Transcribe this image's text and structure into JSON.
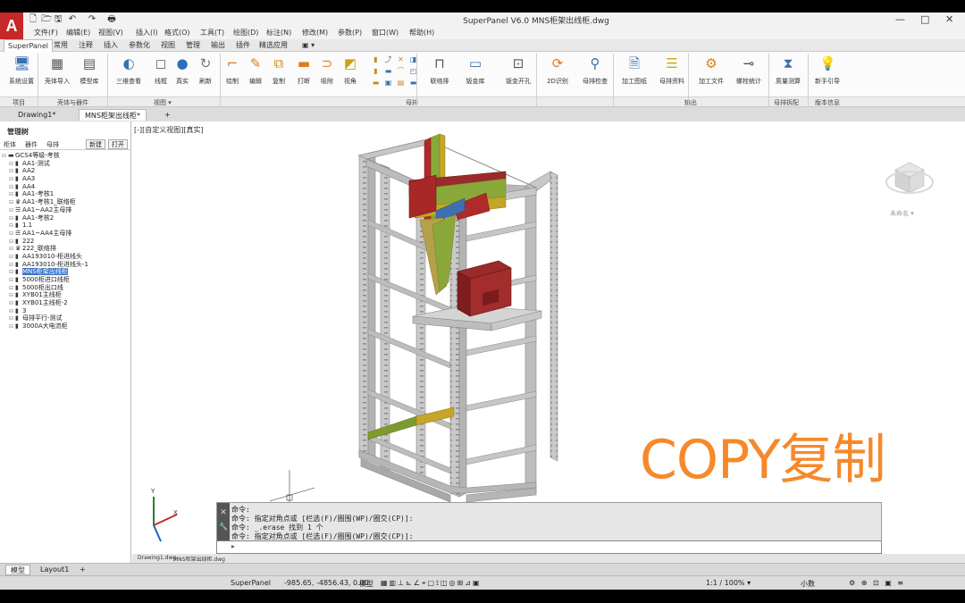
{
  "app": {
    "title": "SuperPanel V6.0    MNS柜架出线柜.dwg",
    "logo": "A",
    "window_controls": [
      "—",
      "□",
      "✕"
    ],
    "quick_access": [
      "🗋",
      "🗁",
      "🖫",
      "↶",
      "↷",
      "🖶"
    ]
  },
  "menu": [
    "文件(F)",
    "编辑(E)",
    "视图(V)",
    "插入(I)",
    "格式(O)",
    "工具(T)",
    "绘图(D)",
    "标注(N)",
    "修改(M)",
    "参数(P)",
    "窗口(W)",
    "帮助(H)"
  ],
  "ribbon_tabs": [
    "SuperPanel",
    "常用",
    "注释",
    "插入",
    "参数化",
    "视图",
    "管理",
    "输出",
    "插件",
    "精选应用",
    "▣ ▾"
  ],
  "ribbon_buttons": [
    {
      "label": "系统设置",
      "icon": "monitor-icon",
      "glyph": "🖥"
    },
    {
      "label": "壳体导入",
      "icon": "cabinet-import-icon",
      "glyph": "▦"
    },
    {
      "label": "模型库",
      "icon": "model-library-icon",
      "glyph": "▤"
    },
    {
      "label": "三维查看",
      "icon": "3d-view-icon",
      "glyph": "◐"
    },
    {
      "label": "线框",
      "icon": "wireframe-icon",
      "glyph": "◻"
    },
    {
      "label": "真实",
      "icon": "realistic-icon",
      "glyph": "●"
    },
    {
      "label": "刷新",
      "icon": "refresh-icon",
      "glyph": "↻"
    },
    {
      "label": "绘制",
      "icon": "draw-busbar-icon",
      "glyph": "⌐"
    },
    {
      "label": "编辑",
      "icon": "edit-busbar-icon",
      "glyph": "✎"
    },
    {
      "label": "复制",
      "icon": "copy-busbar-icon",
      "glyph": "⧉"
    },
    {
      "label": "打断",
      "icon": "break-busbar-icon",
      "glyph": "▬"
    },
    {
      "label": "吸附",
      "icon": "snap-icon",
      "glyph": "⊃"
    },
    {
      "label": "视角",
      "icon": "view-angle-icon",
      "glyph": "◩"
    },
    {
      "label": "联络排",
      "icon": "tie-busbar-icon",
      "glyph": "⊓"
    },
    {
      "label": "钣金库",
      "icon": "sheet-metal-library-icon",
      "glyph": "▭"
    },
    {
      "label": "钣金开孔",
      "icon": "sheet-metal-hole-icon",
      "glyph": "⊡"
    },
    {
      "label": "2D识别",
      "icon": "2d-recognize-icon",
      "glyph": "⟳"
    },
    {
      "label": "母排检查",
      "icon": "busbar-check-icon",
      "glyph": "⚲"
    },
    {
      "label": "加工图纸",
      "icon": "drawing-icon",
      "glyph": "🗎"
    },
    {
      "label": "母排资料",
      "icon": "busbar-data-icon",
      "glyph": "☰"
    },
    {
      "label": "加工文件",
      "icon": "machining-file-icon",
      "glyph": "⚙"
    },
    {
      "label": "螺栓统计",
      "icon": "bolt-count-icon",
      "glyph": "⊸"
    },
    {
      "label": "质量测算",
      "icon": "quality-icon",
      "glyph": "⧗"
    },
    {
      "label": "新手引导",
      "icon": "guide-icon",
      "glyph": "💡"
    }
  ],
  "ribbon_panels": [
    "项目",
    "壳体与器件",
    "视图 ▾",
    "母排",
    "输出",
    "母排拆配",
    "版本信息"
  ],
  "doc_tabs": [
    "Drawing1*",
    "MNS柜架出线柜*",
    "+"
  ],
  "manager": {
    "title": "管理树",
    "tabs": [
      "柜体",
      "器件",
      "母排"
    ],
    "buttons": [
      "新建",
      "打开"
    ],
    "tree": [
      {
        "label": "GCS4等级-考核",
        "icon": "▬",
        "level": 0
      },
      {
        "label": "AA1-测试",
        "icon": "▮",
        "level": 1
      },
      {
        "label": "AA2",
        "icon": "▮",
        "level": 1
      },
      {
        "label": "AA3",
        "icon": "▮",
        "level": 1
      },
      {
        "label": "AA4",
        "icon": "▮",
        "level": 1
      },
      {
        "label": "AA1-考核1",
        "icon": "▮",
        "level": 1
      },
      {
        "label": "AA1-考核1_联络柜",
        "icon": "♛",
        "level": 1
      },
      {
        "label": "AA1~AA2主母排",
        "icon": "☰",
        "level": 1
      },
      {
        "label": "AA1-考核2",
        "icon": "▮",
        "level": 1
      },
      {
        "label": "1.1",
        "icon": "▮",
        "level": 1
      },
      {
        "label": "AA1~AA4主母排",
        "icon": "☰",
        "level": 1
      },
      {
        "label": "222",
        "icon": "▮",
        "level": 1
      },
      {
        "label": "222_联络排",
        "icon": "♛",
        "level": 1
      },
      {
        "label": "AA193010-柜进线头",
        "icon": "▮",
        "level": 1
      },
      {
        "label": "AA193010-柜进线头-1",
        "icon": "▮",
        "level": 1
      },
      {
        "label": "MNS柜架出线柜",
        "icon": "▮",
        "level": 1,
        "selected": true
      },
      {
        "label": "5000柜进口线柜",
        "icon": "▮",
        "level": 1
      },
      {
        "label": "5000柜出口线",
        "icon": "▮",
        "level": 1
      },
      {
        "label": "XYB01主线柜",
        "icon": "▮",
        "level": 1
      },
      {
        "label": "XYB01主线柜-2",
        "icon": "▮",
        "level": 1
      },
      {
        "label": "3",
        "icon": "▮",
        "level": 1
      },
      {
        "label": "母排平行-测试",
        "icon": "▮",
        "level": 1
      },
      {
        "label": "3000A大电流柜",
        "icon": "▮",
        "level": 1
      }
    ]
  },
  "viewport": {
    "label": "[-][自定义视图][真实]",
    "viewcube_label": "未命名 ▾",
    "overlay_text": "COPY复制"
  },
  "command": {
    "lines": [
      "命令:",
      "命令: 指定对角点或 [栏选(F)/圈围(WP)/圈交(CP)]:",
      "命令: _.erase 找到 1 个",
      "命令: 指定对角点或 [栏选(F)/圈围(WP)/圈交(CP)]:"
    ],
    "input_value": ""
  },
  "sheet_tabs": [
    "Drawing1.dwg",
    "MNS柜架出线柜.dwg"
  ],
  "layout_tabs": [
    "模型",
    "Layout1",
    "+"
  ],
  "status": {
    "app": "SuperPanel",
    "coords": "-985.65, -4856.43, 0.00",
    "mode": "模型",
    "scale": "1:1 / 100% ▾",
    "units": "小数"
  }
}
